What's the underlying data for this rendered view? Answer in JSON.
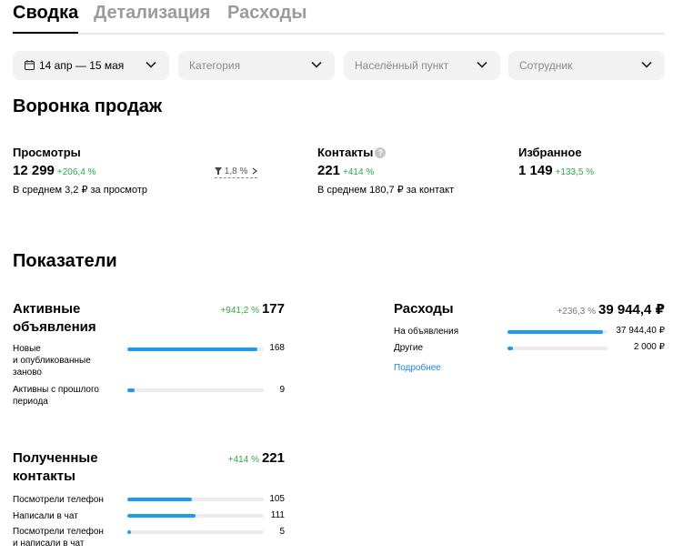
{
  "tabs": [
    {
      "label": "Сводка",
      "active": true
    },
    {
      "label": "Детализация",
      "active": false
    },
    {
      "label": "Расходы",
      "active": false
    }
  ],
  "filters": {
    "date": "14 апр — 15 мая",
    "category_placeholder": "Категория",
    "city_placeholder": "Населённый пункт",
    "employee_placeholder": "Сотрудник"
  },
  "funnel": {
    "title": "Воронка продаж",
    "views": {
      "label": "Просмотры",
      "value": "12 299",
      "change": "+206,4 %",
      "sub": "В среднем 3,2 ₽ за просмотр"
    },
    "conversion": "1,8 %",
    "contacts": {
      "label": "Контакты",
      "help": "?",
      "value": "221",
      "change": "+414 %",
      "sub": "В среднем 180,7 ₽ за контакт"
    },
    "favorites": {
      "label": "Избранное",
      "value": "1 149",
      "change": "+133,5 %"
    }
  },
  "indicators": {
    "title": "Показатели",
    "active_ads": {
      "title_line1": "Активные",
      "title_line2": "объявления",
      "change": "+941,2 %",
      "total": "177",
      "rows": [
        {
          "label_lines": [
            "Новые",
            "и опубликованные",
            "заново"
          ],
          "value": "168",
          "fraction": 0.95
        },
        {
          "label_lines": [
            "Активны с прошлого",
            "периода"
          ],
          "value": "9",
          "fraction": 0.05
        }
      ]
    },
    "expenses": {
      "title": "Расходы",
      "change": "+236,3 %",
      "total": "39 944,4 ₽",
      "rows": [
        {
          "label": "На объявления",
          "value": "37 944,40 ₽",
          "fraction": 0.95
        },
        {
          "label": "Другие",
          "value": "2 000 ₽",
          "fraction": 0.05
        }
      ],
      "more_link": "Подробнее"
    },
    "contacts_received": {
      "title_line1": "Полученные",
      "title_line2": "контакты",
      "change": "+414 %",
      "total": "221",
      "rows": [
        {
          "label_lines": [
            "Посмотрели телефон"
          ],
          "value": "105",
          "fraction": 0.475
        },
        {
          "label_lines": [
            "Написали в чат"
          ],
          "value": "111",
          "fraction": 0.5
        },
        {
          "label_lines": [
            "Посмотрели телефон",
            "и написали в чат"
          ],
          "value": "5",
          "fraction": 0.025
        }
      ]
    }
  }
}
